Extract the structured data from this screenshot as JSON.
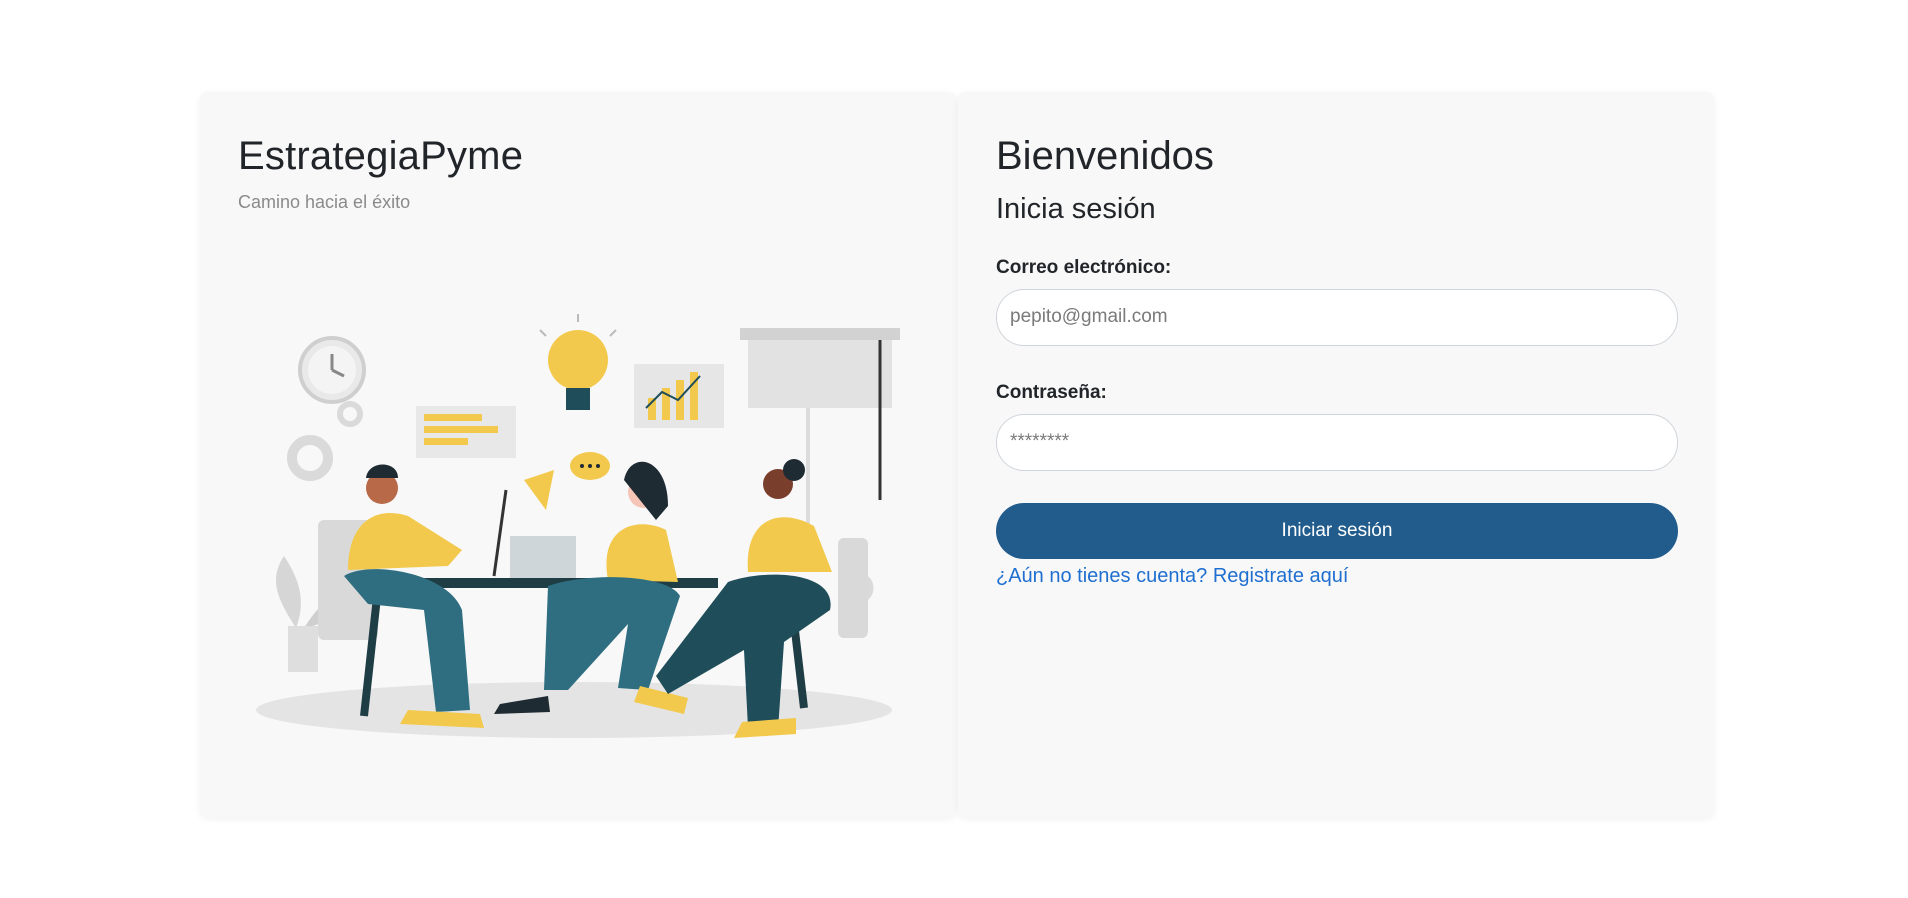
{
  "brand": {
    "title": "EstrategiaPyme",
    "subtitle": "Camino hacia el éxito"
  },
  "illustration": {
    "icon": "team-meeting-illustration",
    "accent_color": "#f2c94c",
    "dark_color": "#1f4e5a"
  },
  "login": {
    "welcome": "Bienvenidos",
    "title": "Inicia sesión",
    "email_label": "Correo electrónico:",
    "email_placeholder": "pepito@gmail.com",
    "password_label": "Contraseña:",
    "password_placeholder": "********",
    "submit_label": "Iniciar sesión",
    "register_link": "¿Aún no tienes cuenta? Registrate aquí",
    "button_color": "#215c8d",
    "link_color": "#1f6fd0"
  }
}
